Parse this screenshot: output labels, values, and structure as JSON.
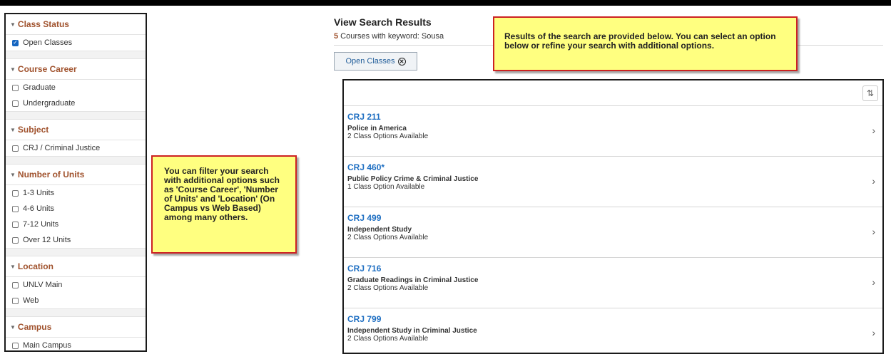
{
  "filters": {
    "groups": [
      {
        "title": "Class Status",
        "options": [
          {
            "label": "Open Classes",
            "checked": true
          }
        ]
      },
      {
        "title": "Course Career",
        "options": [
          {
            "label": "Graduate",
            "checked": false
          },
          {
            "label": "Undergraduate",
            "checked": false
          }
        ]
      },
      {
        "title": "Subject",
        "options": [
          {
            "label": "CRJ / Criminal Justice",
            "checked": false
          }
        ]
      },
      {
        "title": "Number of Units",
        "options": [
          {
            "label": "1-3 Units",
            "checked": false
          },
          {
            "label": "4-6 Units",
            "checked": false
          },
          {
            "label": "7-12 Units",
            "checked": false
          },
          {
            "label": "Over 12 Units",
            "checked": false
          }
        ]
      },
      {
        "title": "Location",
        "options": [
          {
            "label": "UNLV Main",
            "checked": false
          },
          {
            "label": "Web",
            "checked": false
          }
        ]
      },
      {
        "title": "Campus",
        "options": [
          {
            "label": "Main Campus",
            "checked": false
          }
        ]
      }
    ]
  },
  "notes": {
    "left": "You can filter your search with additional options such as 'Course Career', 'Number of Units' and 'Location' (On Campus vs Web Based) among many others.",
    "top": "Results of the search are provided below. You can select an option below or refine your search with additional options."
  },
  "header": {
    "title": "View Search Results",
    "count": "5",
    "count_text": " Courses with keyword: Sousa"
  },
  "chip": {
    "label": "Open Classes"
  },
  "icons": {
    "collapse": "caret-down-icon",
    "remove": "close-circle-icon",
    "sort": "sort-icon",
    "open": "chevron-right-icon"
  },
  "colors": {
    "accent": "#a0522d",
    "link": "#1f6fc2",
    "note_bg": "#ffff80",
    "note_border": "#cc2222"
  },
  "courses": [
    {
      "code": "CRJ 211",
      "title": "Police in America",
      "availability": "2 Class Options Available"
    },
    {
      "code": "CRJ 460*",
      "title": "Public Policy Crime & Criminal Justice",
      "availability": "1 Class Option Available"
    },
    {
      "code": "CRJ 499",
      "title": "Independent Study",
      "availability": "2 Class Options Available"
    },
    {
      "code": "CRJ 716",
      "title": "Graduate Readings in Criminal Justice",
      "availability": "2 Class Options Available"
    },
    {
      "code": "CRJ 799",
      "title": "Independent Study in Criminal Justice",
      "availability": "2 Class Options Available"
    }
  ]
}
